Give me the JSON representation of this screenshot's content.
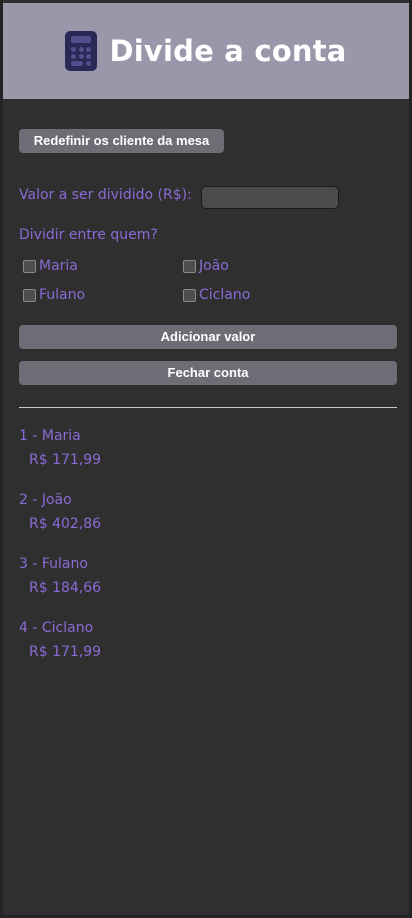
{
  "header": {
    "title": "Divide a conta",
    "icon": "calculator-icon"
  },
  "reset_button": "Redefinir os cliente da mesa",
  "amount": {
    "label": "Valor a ser dividido (R$):",
    "value": ""
  },
  "split_label": "Dividir entre quem?",
  "people_checkboxes": [
    {
      "name": "Maria",
      "checked": false
    },
    {
      "name": "João",
      "checked": false
    },
    {
      "name": "Fulano",
      "checked": false
    },
    {
      "name": "Ciclano",
      "checked": false
    }
  ],
  "add_button": "Adicionar valor",
  "close_button": "Fechar conta",
  "results": [
    {
      "label": "1 - Maria",
      "value": "R$ 171,99"
    },
    {
      "label": "2 - João",
      "value": "R$ 402,86"
    },
    {
      "label": "3 - Fulano",
      "value": "R$ 184,66"
    },
    {
      "label": "4 - Ciclano",
      "value": "R$ 171,99"
    }
  ],
  "colors": {
    "header_bg": "#9b97ab",
    "accent_text": "#8a6bd6",
    "button_bg": "#6e6c74",
    "page_bg": "#2f2f2f"
  }
}
